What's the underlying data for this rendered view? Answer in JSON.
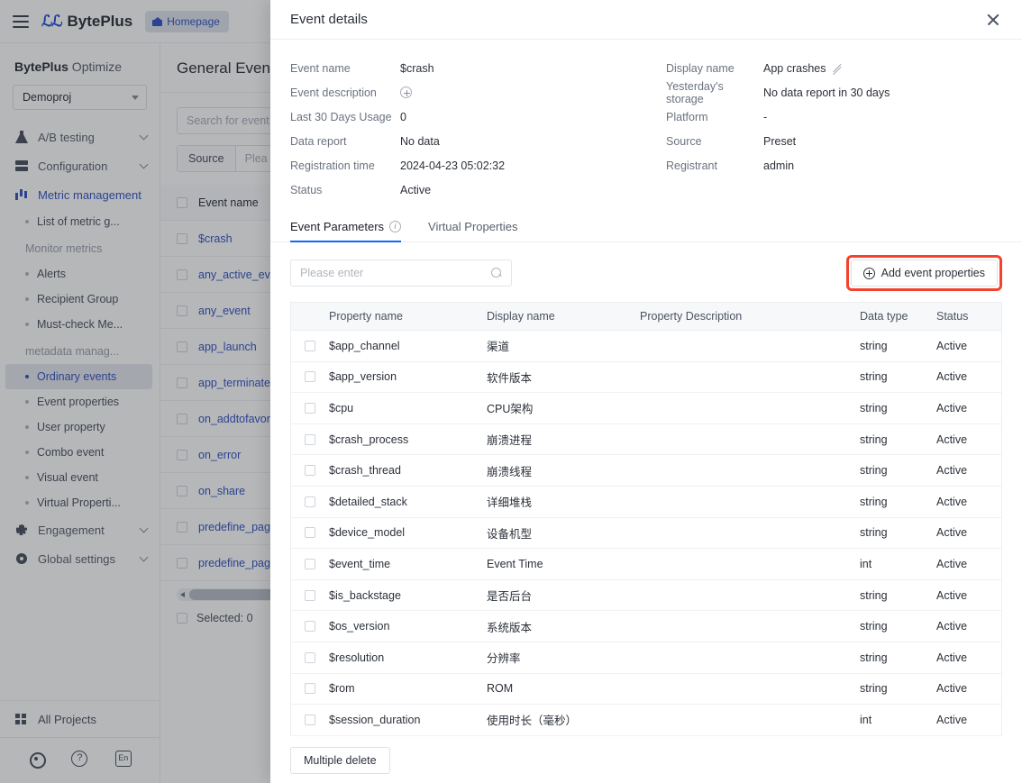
{
  "topbar": {
    "brand_mark": "ℳ",
    "brand_name": "BytePlus",
    "homepage_label": "Homepage"
  },
  "sidebar": {
    "title_bold": "BytePlus",
    "title_rest": " Optimize",
    "project_selected": "Demoproj",
    "groups": [
      {
        "label": "A/B testing",
        "icon": "flask-icon"
      },
      {
        "label": "Configuration",
        "icon": "config-icon"
      },
      {
        "label": "Metric management",
        "icon": "bar-chart-icon"
      }
    ],
    "sub_items": [
      {
        "label": "List of metric g...",
        "type": "item"
      },
      {
        "label": "Monitor metrics",
        "type": "section"
      },
      {
        "label": "Alerts",
        "type": "item"
      },
      {
        "label": "Recipient Group",
        "type": "item"
      },
      {
        "label": "Must-check Me...",
        "type": "item"
      },
      {
        "label": "metadata manag...",
        "type": "section"
      },
      {
        "label": "Ordinary events",
        "type": "selected"
      },
      {
        "label": "Event properties",
        "type": "item"
      },
      {
        "label": "User property",
        "type": "item"
      },
      {
        "label": "Combo event",
        "type": "item"
      },
      {
        "label": "Visual event",
        "type": "item"
      },
      {
        "label": "Virtual Properti...",
        "type": "item"
      }
    ],
    "groups_bottom": [
      {
        "label": "Engagement",
        "icon": "puzzle-icon"
      },
      {
        "label": "Global settings",
        "icon": "gear-icon"
      }
    ],
    "all_projects": "All Projects",
    "lang_label": "En"
  },
  "page": {
    "title": "General Events",
    "search_placeholder": "Search for event n",
    "filter_label": "Source",
    "filter_placeholder": "Plea",
    "table_header": "Event name",
    "rows": [
      "$crash",
      "any_active_eve",
      "any_event",
      "app_launch",
      "app_terminate",
      "on_addtofavor",
      "on_error",
      "on_share",
      "predefine_pag",
      "predefine_pag"
    ],
    "selected_label": "Selected: 0"
  },
  "modal": {
    "title": "Event details",
    "details_left": [
      {
        "label": "Event name",
        "value": "$crash"
      },
      {
        "label": "Event description",
        "value": "",
        "icon": "plus-circle-icon"
      },
      {
        "label": "Last 30 Days Usage",
        "value": "0"
      },
      {
        "label": "Data report",
        "value": "No data"
      },
      {
        "label": "Registration time",
        "value": "2024-04-23 05:02:32"
      },
      {
        "label": "Status",
        "value": "Active"
      }
    ],
    "details_right": [
      {
        "label": "Display name",
        "value": "App crashes",
        "icon": "pencil-icon"
      },
      {
        "label": "Yesterday's storage",
        "value": "No data report in 30 days"
      },
      {
        "label": "Platform",
        "value": "-"
      },
      {
        "label": "Source",
        "value": "Preset"
      },
      {
        "label": "Registrant",
        "value": "admin"
      }
    ],
    "tabs": [
      {
        "label": "Event Parameters",
        "active": true,
        "has_info": true
      },
      {
        "label": "Virtual Properties",
        "active": false,
        "has_info": false
      }
    ],
    "search_placeholder": "Please enter",
    "add_button": "Add event properties",
    "add_button_highlight_color": "#f5422c",
    "columns": [
      "Property name",
      "Display name",
      "Property Description",
      "Data type",
      "Status"
    ],
    "properties": [
      {
        "name": "$app_channel",
        "display": "渠道",
        "desc": "",
        "type": "string",
        "status": "Active"
      },
      {
        "name": "$app_version",
        "display": "软件版本",
        "desc": "",
        "type": "string",
        "status": "Active"
      },
      {
        "name": "$cpu",
        "display": "CPU架构",
        "desc": "",
        "type": "string",
        "status": "Active"
      },
      {
        "name": "$crash_process",
        "display": "崩溃进程",
        "desc": "",
        "type": "string",
        "status": "Active"
      },
      {
        "name": "$crash_thread",
        "display": "崩溃线程",
        "desc": "",
        "type": "string",
        "status": "Active"
      },
      {
        "name": "$detailed_stack",
        "display": "详细堆栈",
        "desc": "",
        "type": "string",
        "status": "Active"
      },
      {
        "name": "$device_model",
        "display": "设备机型",
        "desc": "",
        "type": "string",
        "status": "Active"
      },
      {
        "name": "$event_time",
        "display": "Event Time",
        "desc": "",
        "type": "int",
        "status": "Active"
      },
      {
        "name": "$is_backstage",
        "display": "是否后台",
        "desc": "",
        "type": "string",
        "status": "Active"
      },
      {
        "name": "$os_version",
        "display": "系统版本",
        "desc": "",
        "type": "string",
        "status": "Active"
      },
      {
        "name": "$resolution",
        "display": "分辨率",
        "desc": "",
        "type": "string",
        "status": "Active"
      },
      {
        "name": "$rom",
        "display": "ROM",
        "desc": "",
        "type": "string",
        "status": "Active"
      },
      {
        "name": "$session_duration",
        "display": "使用时长（毫秒）",
        "desc": "",
        "type": "int",
        "status": "Active"
      }
    ],
    "multiple_delete": "Multiple delete"
  }
}
